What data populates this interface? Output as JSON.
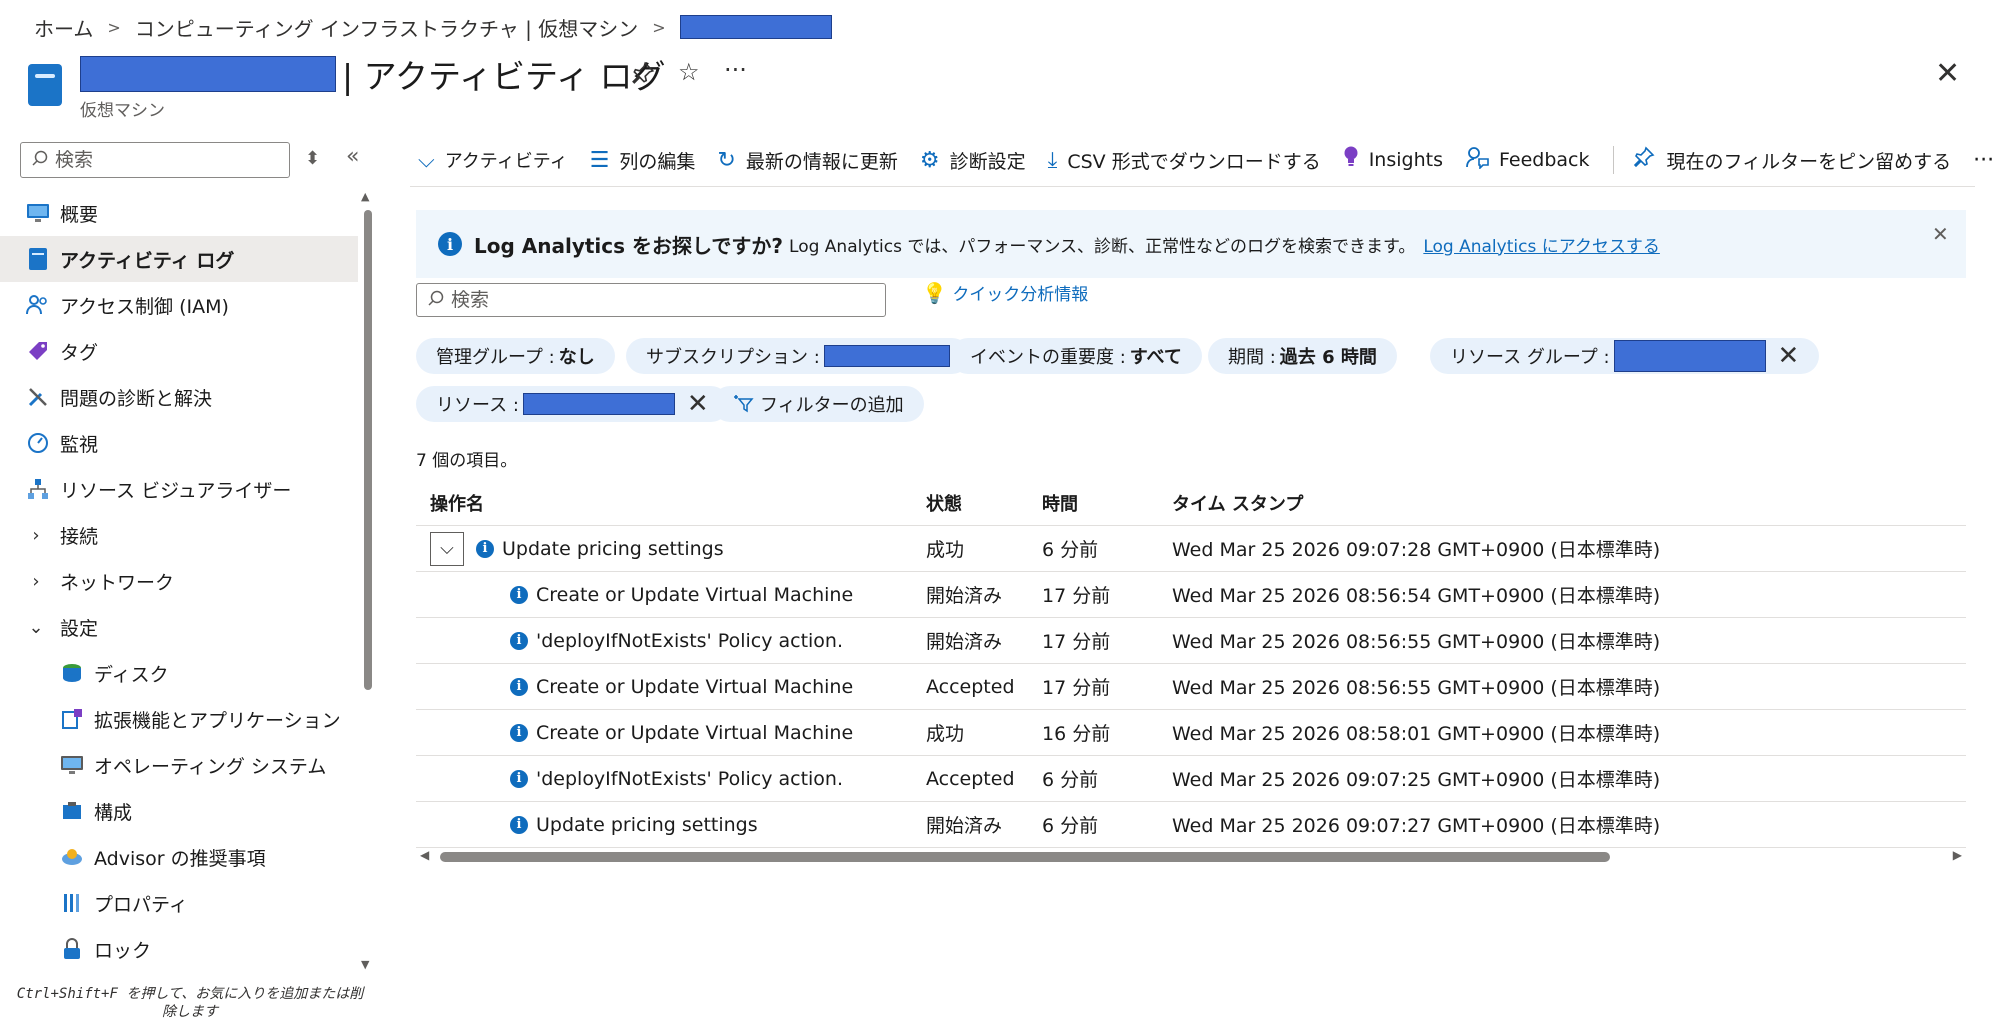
{
  "breadcrumb": [
    "ホーム",
    "コンピューティング インフラストラクチャ | 仮想マシン"
  ],
  "header": {
    "title": "| アクティビティ ログ",
    "subtitle": "仮想マシン"
  },
  "sidebar": {
    "search_placeholder": "検索",
    "items": [
      {
        "label": "概要",
        "icon": "monitor-icon"
      },
      {
        "label": "アクティビティ ログ",
        "icon": "activity-log-icon",
        "active": true
      },
      {
        "label": "アクセス制御 (IAM)",
        "icon": "people-icon"
      },
      {
        "label": "タグ",
        "icon": "tag-icon"
      },
      {
        "label": "問題の診断と解決",
        "icon": "wrench-icon"
      },
      {
        "label": "監視",
        "icon": "gauge-icon"
      },
      {
        "label": "リソース ビジュアライザー",
        "icon": "hierarchy-icon"
      },
      {
        "label": "接続",
        "chevron": "right"
      },
      {
        "label": "ネットワーク",
        "chevron": "right"
      },
      {
        "label": "設定",
        "chevron": "down"
      },
      {
        "label": "ディスク",
        "icon": "disk-icon",
        "indent": true
      },
      {
        "label": "拡張機能とアプリケーション",
        "icon": "extension-icon",
        "indent": true
      },
      {
        "label": "オペレーティング システム",
        "icon": "os-icon",
        "indent": true
      },
      {
        "label": "構成",
        "icon": "config-icon",
        "indent": true
      },
      {
        "label": "Advisor の推奨事項",
        "icon": "advisor-icon",
        "indent": true
      },
      {
        "label": "プロパティ",
        "icon": "properties-icon",
        "indent": true
      },
      {
        "label": "ロック",
        "icon": "lock-icon",
        "indent": true
      }
    ],
    "hint": "Ctrl+Shift+F を押して、お気に入りを追加または削除します"
  },
  "toolbar": {
    "activity": "アクティビティ",
    "edit_columns": "列の編集",
    "refresh": "最新の情報に更新",
    "diagnostics": "診断設定",
    "download_csv": "CSV 形式でダウンロードする",
    "insights": "Insights",
    "feedback": "Feedback",
    "pin_filter": "現在のフィルターをピン留めする"
  },
  "banner": {
    "title": "Log Analytics をお探しですか?",
    "text": "Log Analytics では、パフォーマンス、診断、正常性などのログを検索できます。",
    "link": "Log Analytics にアクセスする"
  },
  "search": {
    "placeholder": "検索"
  },
  "quick_insights": "クイック分析情報",
  "filters": {
    "mgmt_group_label": "管理グループ :",
    "mgmt_group_value": "なし",
    "subscription_label": "サブスクリプション :",
    "severity_label": "イベントの重要度 :",
    "severity_value": "すべて",
    "period_label": "期間 :",
    "period_value": "過去 6 時間",
    "resource_group_label": "リソース グループ :",
    "resource_label": "リソース :",
    "add_filter": "フィルターの追加"
  },
  "item_count": "7 個の項目。",
  "table": {
    "columns": [
      "操作名",
      "状態",
      "時間",
      "タイム スタンプ"
    ],
    "rows": [
      {
        "op": "Update pricing settings",
        "status": "成功",
        "time": "6 分前",
        "ts": "Wed Mar 25 2026 09:07:28 GMT+0900 (日本標準時)",
        "parent": true
      },
      {
        "op": "Create or Update Virtual Machine",
        "status": "開始済み",
        "time": "17 分前",
        "ts": "Wed Mar 25 2026 08:56:54 GMT+0900 (日本標準時)"
      },
      {
        "op": "'deployIfNotExists' Policy action.",
        "status": "開始済み",
        "time": "17 分前",
        "ts": "Wed Mar 25 2026 08:56:55 GMT+0900 (日本標準時)"
      },
      {
        "op": "Create or Update Virtual Machine",
        "status": "Accepted",
        "time": "17 分前",
        "ts": "Wed Mar 25 2026 08:56:55 GMT+0900 (日本標準時)"
      },
      {
        "op": "Create or Update Virtual Machine",
        "status": "成功",
        "time": "16 分前",
        "ts": "Wed Mar 25 2026 08:58:01 GMT+0900 (日本標準時)"
      },
      {
        "op": "'deployIfNotExists' Policy action.",
        "status": "Accepted",
        "time": "6 分前",
        "ts": "Wed Mar 25 2026 09:07:25 GMT+0900 (日本標準時)"
      },
      {
        "op": "Update pricing settings",
        "status": "開始済み",
        "time": "6 分前",
        "ts": "Wed Mar 25 2026 09:07:27 GMT+0900 (日本標準時)"
      }
    ]
  }
}
